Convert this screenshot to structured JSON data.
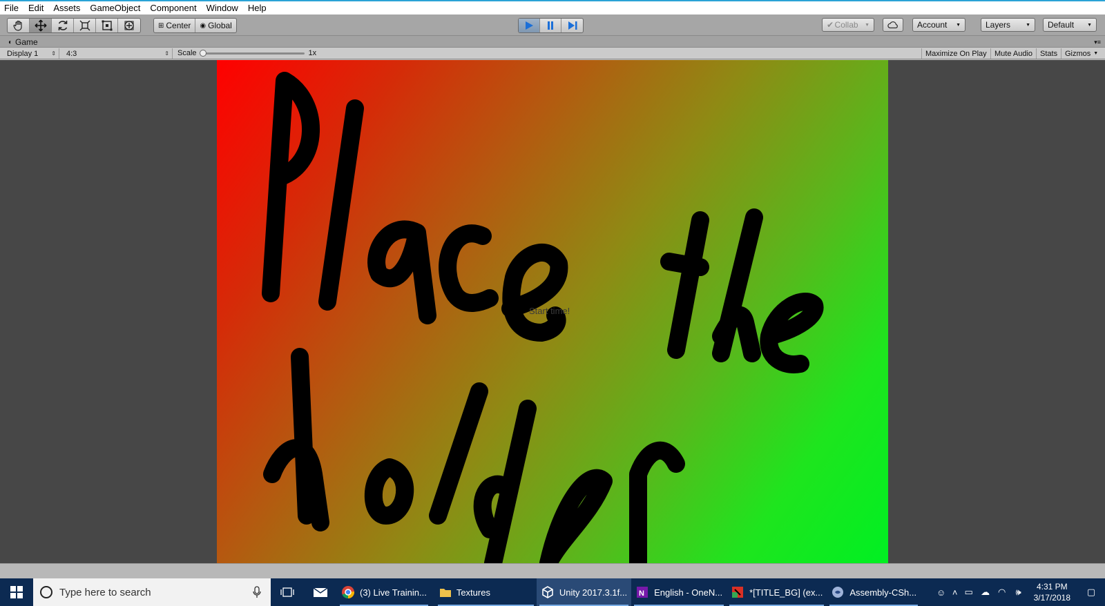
{
  "menu": [
    "File",
    "Edit",
    "Assets",
    "GameObject",
    "Component",
    "Window",
    "Help"
  ],
  "toolbar": {
    "pivot_center": "Center",
    "pivot_global": "Global",
    "collab": "Collab",
    "account": "Account",
    "layers": "Layers",
    "layout": "Default"
  },
  "game_tab": {
    "title": "Game"
  },
  "game_toolbar": {
    "display": "Display 1",
    "aspect": "4:3",
    "scale_label": "Scale",
    "scale_value": "1x",
    "maximize": "Maximize On Play",
    "mute": "Mute Audio",
    "stats": "Stats",
    "gizmos": "Gizmos"
  },
  "game_view": {
    "overlay_text": "Start time!"
  },
  "taskbar": {
    "search_placeholder": "Type here to search",
    "apps": [
      {
        "label": "(3) Live Trainin...",
        "icon": "chrome-icon"
      },
      {
        "label": "Textures",
        "icon": "folder-icon"
      },
      {
        "label": "Unity 2017.3.1f...",
        "icon": "unity-icon"
      },
      {
        "label": "English - OneN...",
        "icon": "onenote-icon"
      },
      {
        "label": "*[TITLE_BG] (ex...",
        "icon": "paint-icon"
      },
      {
        "label": "Assembly-CSh...",
        "icon": "visualstudio-icon"
      }
    ],
    "time": "4:31 PM",
    "date": "3/17/2018"
  }
}
